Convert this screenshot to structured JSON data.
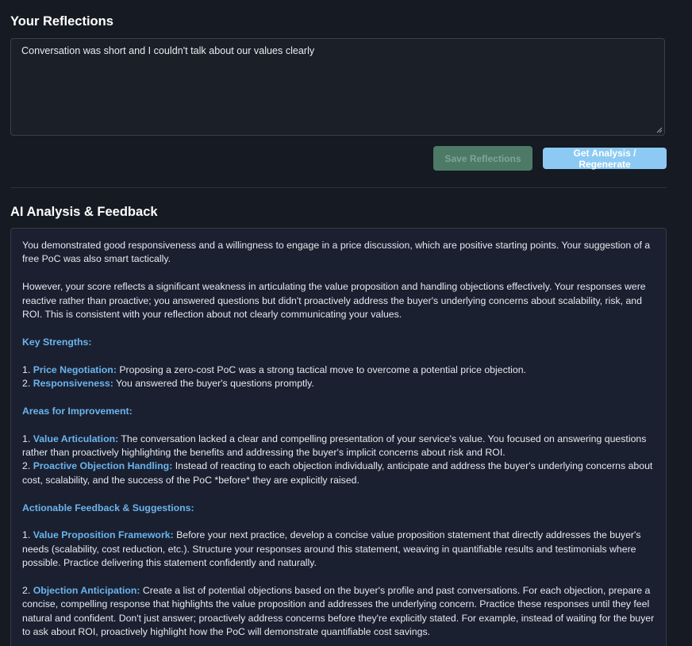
{
  "reflections": {
    "title": "Your Reflections",
    "text": "Conversation was short and I couldn't talk about our values clearly",
    "save_label": "Save Reflections",
    "analysis_label": "Get Analysis / Regenerate"
  },
  "analysis": {
    "title": "AI Analysis & Feedback",
    "p1": "You demonstrated good responsiveness and a willingness to engage in a price discussion, which are positive starting points.  Your suggestion of a free PoC was also smart tactically.",
    "p2": "However, your score reflects a significant weakness in articulating the value proposition and handling objections effectively.  Your responses were reactive rather than proactive; you answered questions but didn't proactively address the buyer's underlying concerns about scalability, risk, and ROI.  This is consistent with your reflection about not clearly communicating your values.",
    "strengths_heading": "Key Strengths:",
    "s1_num": "1. ",
    "s1_label": "Price Negotiation:",
    "s1_text": "  Proposing a zero-cost PoC was a strong tactical move to overcome a potential price objection.",
    "s2_num": "2. ",
    "s2_label": "Responsiveness:",
    "s2_text": " You answered the buyer's questions promptly.",
    "improvement_heading": "Areas for Improvement:",
    "i1_num": "1. ",
    "i1_label": "Value Articulation:",
    "i1_text": " The conversation lacked a clear and compelling presentation of your service's value.  You focused on answering questions rather than proactively highlighting the benefits and addressing the buyer's implicit concerns about risk and ROI.",
    "i2_num": "2. ",
    "i2_label": "Proactive Objection Handling:",
    "i2_text": "  Instead of reacting to each objection individually,  anticipate and address the buyer's underlying concerns about cost, scalability, and the success of the PoC *before* they are explicitly raised.",
    "suggestions_heading": "Actionable Feedback & Suggestions:",
    "a1_num": "1. ",
    "a1_label": "Value Proposition Framework:",
    "a1_text": " Before your next practice, develop a concise value proposition statement that directly addresses the buyer's needs (scalability, cost reduction, etc.).  Structure your responses around this statement, weaving in quantifiable results and testimonials where possible.  Practice delivering this statement confidently and naturally.",
    "a2_num": "2. ",
    "a2_label": "Objection Anticipation:",
    "a2_text": " Create a list of potential objections based on the buyer's profile and past conversations.  For each objection, prepare a concise, compelling response that highlights the value proposition and addresses the underlying concern.  Practice these responses until they feel natural and confident.  Don't just answer; proactively address concerns before they're explicitly stated.  For example, instead of waiting for the buyer to ask about ROI, proactively highlight how the PoC will demonstrate quantifiable cost savings."
  },
  "colors": {
    "background": "#161a22",
    "accent_blue": "#6ab4ee",
    "save_button": "#4c7a67",
    "analysis_button": "#8ccaf3"
  }
}
